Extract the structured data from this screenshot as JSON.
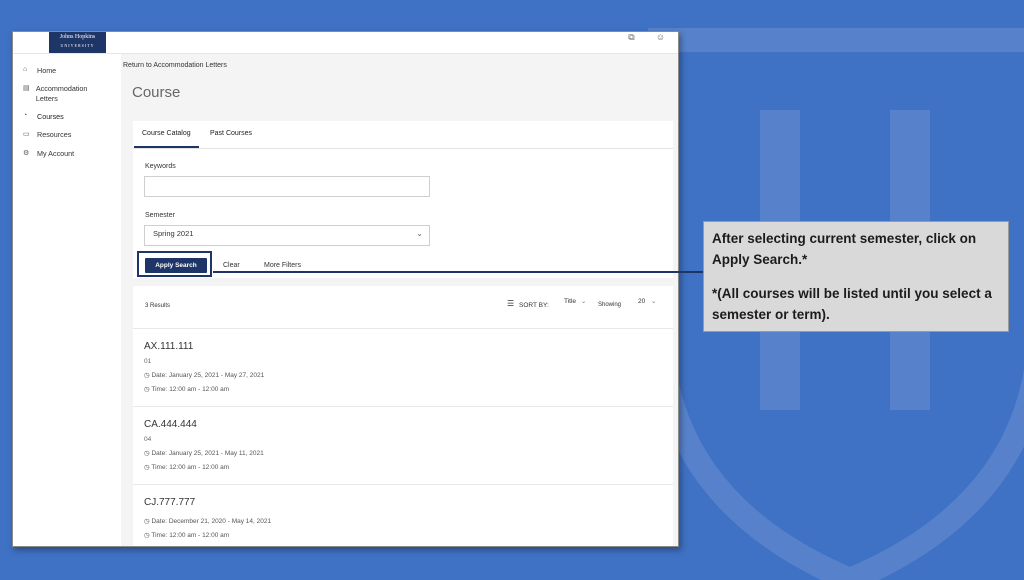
{
  "colors": {
    "background": "#3f71c4",
    "navy": "#1d3567",
    "callout_bg": "#d9d9d9"
  },
  "logo": {
    "line1": "Johns Hopkins",
    "line2": "UNIVERSITY"
  },
  "topbar": {
    "icons": [
      "external-link-icon",
      "user-icon"
    ]
  },
  "sidebar": {
    "items": [
      {
        "icon": "home-icon",
        "label": "Home"
      },
      {
        "icon": "letters-icon",
        "label": "Accommodation Letters"
      },
      {
        "icon": "courses-icon",
        "label": "Courses"
      },
      {
        "icon": "resources-icon",
        "label": "Resources"
      },
      {
        "icon": "account-icon",
        "label": "My Account"
      }
    ]
  },
  "breadcrumb": "Return to Accommodation Letters",
  "page_title": "Course",
  "tabs": [
    {
      "label": "Course Catalog"
    },
    {
      "label": "Past Courses"
    }
  ],
  "filters": {
    "keywords_label": "Keywords",
    "keywords_value": "",
    "semester_label": "Semester",
    "semester_value": "Spring 2021",
    "apply_label": "Apply Search",
    "clear_label": "Clear",
    "more_filters_label": "More Filters"
  },
  "results": {
    "count": "3 Results",
    "sort_by_label": "SORT BY:",
    "sort_value": "Title",
    "showing_label": "Showing",
    "showing_value": "20",
    "courses": [
      {
        "code": "AX.111.111",
        "section": "01",
        "date": "Date: January 25, 2021 - May 27, 2021",
        "time": "Time: 12:00 am - 12:00 am"
      },
      {
        "code": "CA.444.444",
        "section": "04",
        "date": "Date: January 25, 2021 - May 11, 2021",
        "time": "Time: 12:00 am - 12:00 am"
      },
      {
        "code": "CJ.777.777",
        "section": "",
        "date": "Date: December 21, 2020 - May 14, 2021",
        "time": "Time: 12:00 am - 12:00 am"
      }
    ]
  },
  "callout": {
    "line1": "After selecting current semester, click on Apply Search.*",
    "line2": "*(All courses will be listed until you select a semester or term)."
  }
}
